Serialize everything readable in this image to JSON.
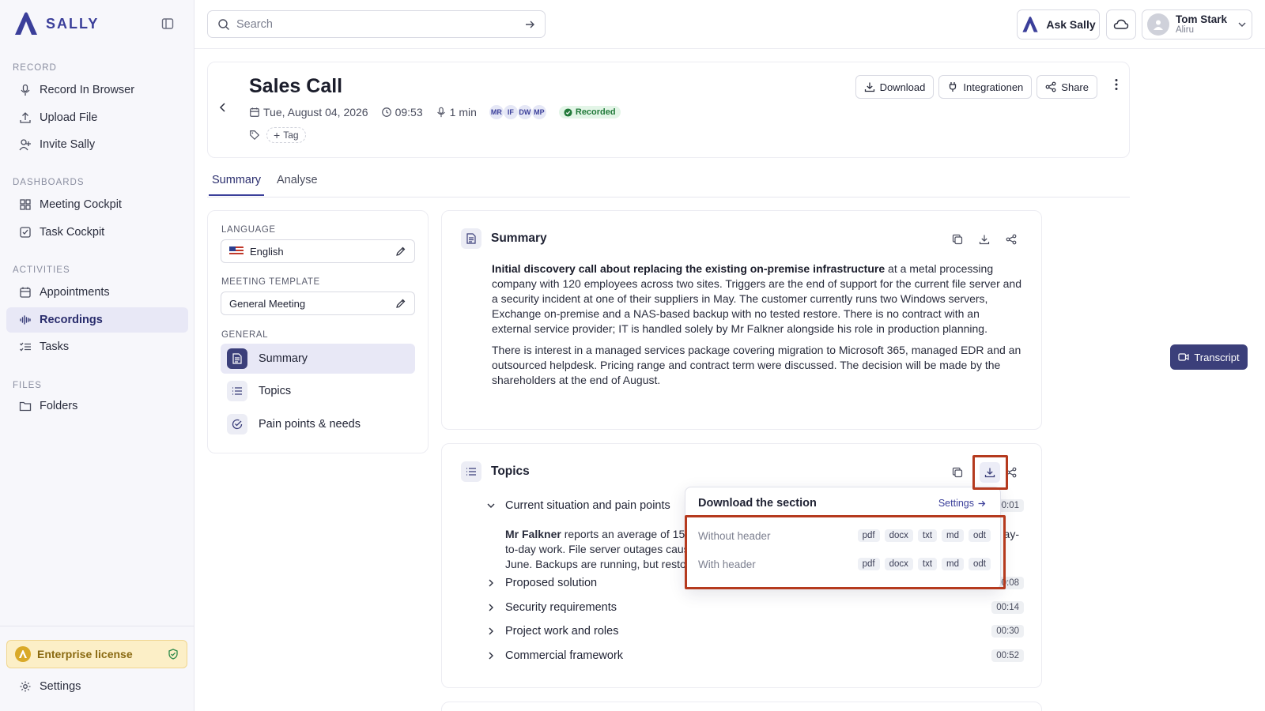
{
  "app": {
    "brand": "SALLY"
  },
  "sidebar": {
    "sections": {
      "record": "RECORD",
      "dashboards": "DASHBOARDS",
      "activities": "ACTIVITIES",
      "files": "FILES"
    },
    "items": {
      "record_browser": "Record In Browser",
      "upload_file": "Upload File",
      "invite_sally": "Invite Sally",
      "meeting_cockpit": "Meeting Cockpit",
      "task_cockpit": "Task Cockpit",
      "appointments": "Appointments",
      "recordings": "Recordings",
      "tasks": "Tasks",
      "folders": "Folders",
      "settings": "Settings"
    },
    "license": "Enterprise license"
  },
  "topbar": {
    "search_placeholder": "Search",
    "ask_sally": "Ask Sally",
    "user_name": "Tom Stark",
    "user_org": "Aliru"
  },
  "meeting": {
    "title": "Sales Call",
    "date": "Tue, August 04, 2026",
    "time": "09:53",
    "duration": "1 min",
    "participants": [
      "MR",
      "IF",
      "DW",
      "MP"
    ],
    "status": "Recorded",
    "tag_label": "Tag",
    "actions": {
      "download": "Download",
      "integrations": "Integrationen",
      "share": "Share"
    }
  },
  "tabs": {
    "summary": "Summary",
    "analyse": "Analyse"
  },
  "left_panel": {
    "language_label": "LANGUAGE",
    "language_value": "English",
    "template_label": "MEETING TEMPLATE",
    "template_value": "General Meeting",
    "general_label": "GENERAL",
    "items": {
      "summary": "Summary",
      "topics": "Topics",
      "pain_points": "Pain points & needs"
    }
  },
  "summary_card": {
    "title": "Summary",
    "lead_bold": "Initial discovery call about replacing the existing on-premise infrastructure",
    "lead_rest": " at a metal processing company with 120 employees across two sites. Triggers are the end of support for the current file server and a security incident at one of their suppliers in May. The customer currently runs two Windows servers, Exchange on-premise and a NAS-based backup with no tested restore. There is no contract with an external service provider; IT is handled solely by Mr Falkner alongside his role in production planning.",
    "para2": "There is interest in a managed services package covering migration to Microsoft 365, managed EDR and an outsourced helpdesk. Pricing range and contract term were discussed. The decision will be made by the shareholders at the end of August."
  },
  "topics_card": {
    "title": "Topics",
    "topics": [
      {
        "title": "Current situation and pain points",
        "time": "00:01"
      },
      {
        "title": "Proposed solution",
        "time": "00:08"
      },
      {
        "title": "Security requirements",
        "time": "00:14"
      },
      {
        "title": "Project work and roles",
        "time": "00:30"
      },
      {
        "title": "Commercial framework",
        "time": "00:52"
      }
    ],
    "body_bold": "Mr Falkner",
    "body_rest": " reports an average of 15 to",
    "body_tail": "ay-",
    "body_line2": "to-day work. File server outages caus",
    "body_line3": "June. Backups are running, but resto"
  },
  "download_popover": {
    "title": "Download the section",
    "settings": "Settings",
    "rows": [
      {
        "label": "Without header",
        "formats": [
          "pdf",
          "docx",
          "txt",
          "md",
          "odt"
        ]
      },
      {
        "label": "With header",
        "formats": [
          "pdf",
          "docx",
          "txt",
          "md",
          "odt"
        ]
      }
    ]
  },
  "transcript_button": "Transcript",
  "colors": {
    "accent": "#3b3f9a",
    "highlight": "#b53a1e",
    "license_bg": "#fcefc7"
  }
}
